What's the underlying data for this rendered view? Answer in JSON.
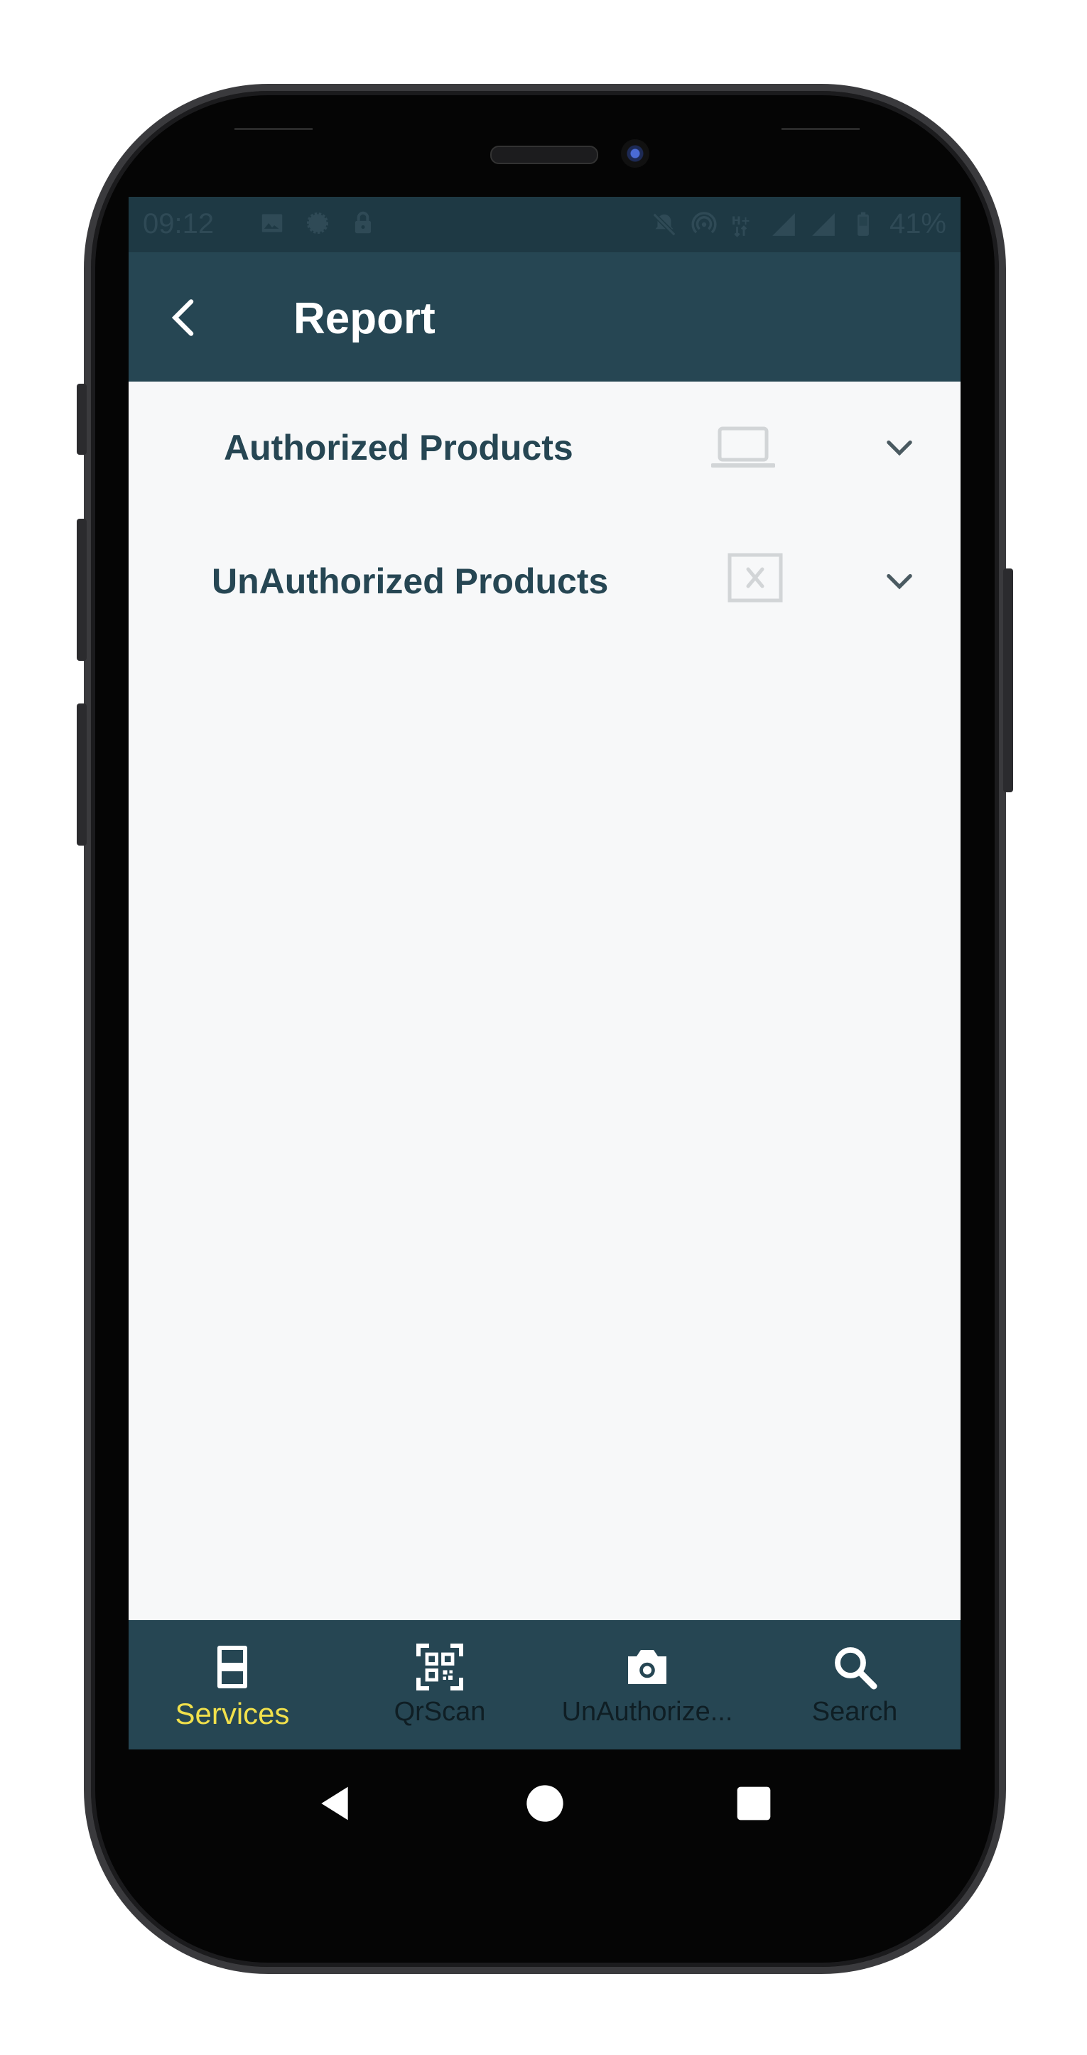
{
  "status_bar": {
    "time": "09:12",
    "battery": "41%",
    "left_icons": [
      "image-icon",
      "signal-app-icon",
      "lock-icon"
    ],
    "right_icons": [
      "notifications-off-icon",
      "hotspot-icon",
      "hplus-network-icon",
      "cell-signal-icon",
      "cell-signal-icon",
      "battery-icon"
    ]
  },
  "app_bar": {
    "title": "Report",
    "back_icon": "chevron-left-icon"
  },
  "list": {
    "items": [
      {
        "label": "Authorized Products",
        "icon": "laptop-icon",
        "expand_icon": "chevron-down-icon"
      },
      {
        "label": "UnAuthorized Products",
        "icon": "broken-image-icon",
        "expand_icon": "chevron-down-icon"
      }
    ]
  },
  "bottom_nav": {
    "items": [
      {
        "label": "Services",
        "icon": "services-icon",
        "active": true
      },
      {
        "label": "QrScan",
        "icon": "qr-code-icon",
        "active": false
      },
      {
        "label": "UnAuthorize...",
        "icon": "camera-icon",
        "active": false
      },
      {
        "label": "Search",
        "icon": "search-icon",
        "active": false
      }
    ]
  },
  "colors": {
    "primary": "#264653",
    "status_bar": "#1e3944",
    "background": "#f7f8f9",
    "active_tab": "#f1e04b",
    "text_primary": "#264653"
  }
}
